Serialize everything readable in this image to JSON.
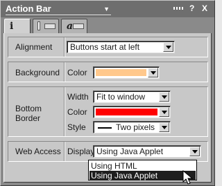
{
  "window": {
    "title": "Action Bar",
    "controls": {
      "help": "?",
      "close": "X"
    }
  },
  "tabs": [
    {
      "glyph": "i",
      "active": true
    },
    {
      "glyph": "",
      "active": false
    },
    {
      "glyph": "a",
      "active": false
    }
  ],
  "alignment": {
    "label": "Alignment",
    "value": "Buttons start at left"
  },
  "background": {
    "label": "Background",
    "color_label": "Color",
    "color_value": "#ffc88c"
  },
  "bottom_border": {
    "label_line1": "Bottom",
    "label_line2": "Border",
    "width_label": "Width",
    "width_value": "Fit to window",
    "color_label": "Color",
    "color_value": "#ff0000",
    "style_label": "Style",
    "style_value": "Two pixels"
  },
  "web_access": {
    "label": "Web Access",
    "display_label": "Display",
    "display_value": "Using Java Applet",
    "options": [
      "Using HTML",
      "Using Java Applet"
    ],
    "highlighted_option": "Using Java Applet"
  }
}
